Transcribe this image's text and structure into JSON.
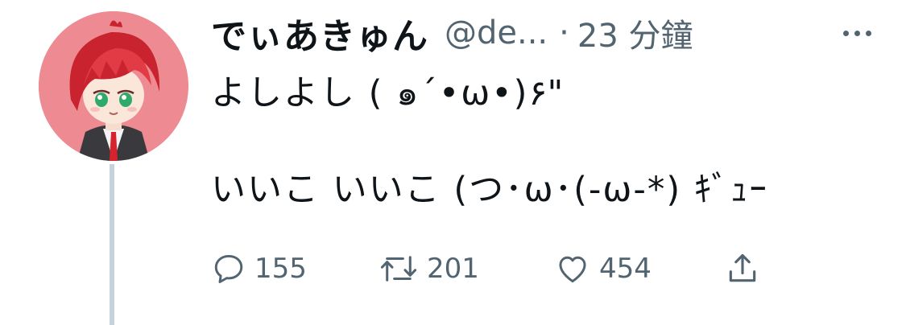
{
  "tweet": {
    "display_name": "でぃあきゅん",
    "handle": "@de...",
    "dot": "·",
    "time": "23 分鐘",
    "text": "よしよし ( ๑´•ω•)۶\"\n\nいいこ いいこ (つ･ω･(-ω-*) ｷﾞｭｰ",
    "reply_count": "155",
    "retweet_count": "201",
    "like_count": "454"
  },
  "icons": {
    "more": "more-horizontal-icon",
    "reply": "reply-icon",
    "retweet": "retweet-icon",
    "like": "heart-icon",
    "share": "share-icon",
    "avatar": "avatar-image"
  },
  "colors": {
    "text_primary": "#0f1419",
    "text_secondary": "#536471",
    "thread_line": "#c8d2da",
    "avatar_bg": "#ee8a91"
  }
}
